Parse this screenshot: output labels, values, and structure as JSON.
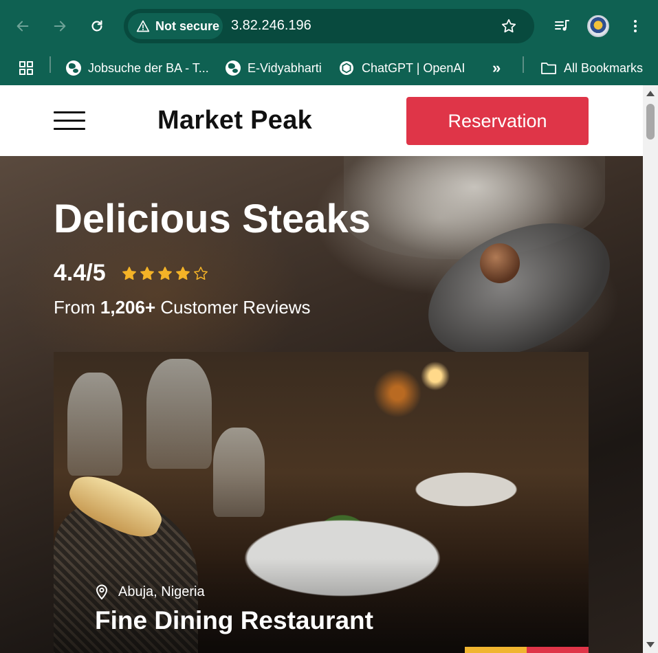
{
  "browser": {
    "security_label": "Not secure",
    "url": "3.82.246.196",
    "bookmarks": [
      {
        "label": "Jobsuche der BA - T..."
      },
      {
        "label": "E-Vidyabharti"
      },
      {
        "label": "ChatGPT | OpenAI"
      }
    ],
    "all_bookmarks_label": "All Bookmarks",
    "overflow_label": "»"
  },
  "site": {
    "brand": "Market Peak",
    "reservation_label": "Reservation",
    "accent_color": "#df3548"
  },
  "hero": {
    "title": "Delicious Steaks",
    "rating": "4.4/5",
    "stars_filled": 4,
    "stars_total": 5,
    "reviews_prefix": "From",
    "reviews_count": "1,206+",
    "reviews_suffix": "Customer Reviews"
  },
  "feature": {
    "location": "Abuja, Nigeria",
    "title": "Fine Dining Restaurant",
    "accent_colors": [
      "#f0b530",
      "#df3548"
    ]
  },
  "colors": {
    "chrome_bg": "#0f6152",
    "omnibox_bg": "#084a3e",
    "star_color": "#f4b327"
  }
}
